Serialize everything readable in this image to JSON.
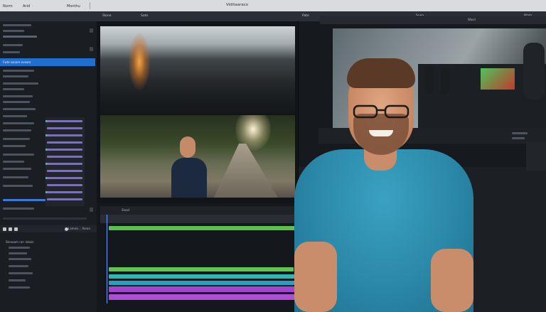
{
  "menubar": {
    "items": [
      "Norm",
      "Arid",
      "Monthu"
    ],
    "title": "Viditaaraco"
  },
  "toolbar": {
    "items": [
      "Slone",
      "Sate",
      "Pate",
      "Soeo",
      "Wato"
    ]
  },
  "left_panel": {
    "selected_item": "Fwte sanare oveoro",
    "heading": "Stenoam rarr iokoin",
    "footer_label": "Lameis ∴ Aeron"
  },
  "timeline": {
    "ruler_label": "Slood"
  },
  "monitor": {
    "header_label": "Wasd"
  }
}
